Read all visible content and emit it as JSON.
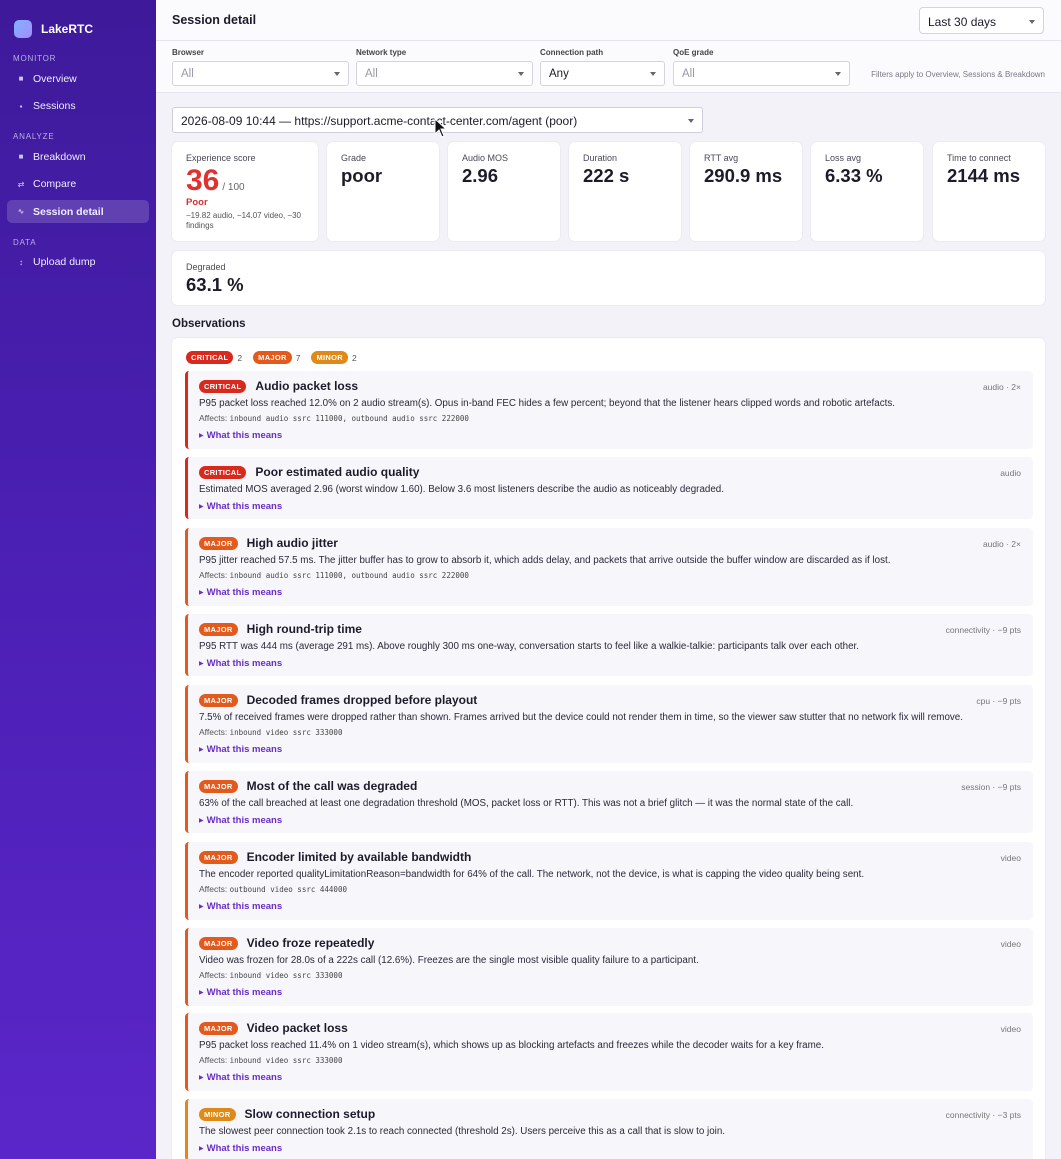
{
  "app": {
    "name": "LakeRTC"
  },
  "sidebar": {
    "sections": [
      {
        "label": "MONITOR",
        "items": [
          {
            "label": "Overview"
          },
          {
            "label": "Sessions"
          }
        ]
      },
      {
        "label": "ANALYZE",
        "items": [
          {
            "label": "Breakdown"
          },
          {
            "label": "Compare"
          },
          {
            "label": "Session detail",
            "active": true
          }
        ]
      },
      {
        "label": "DATA",
        "items": [
          {
            "label": "Upload dump"
          }
        ]
      }
    ]
  },
  "header": {
    "title": "Session detail",
    "range": "Last 30 days"
  },
  "filters": {
    "browser": {
      "label": "Browser",
      "value": "All"
    },
    "network": {
      "label": "Network type",
      "value": "All"
    },
    "path": {
      "label": "Connection path",
      "value": "Any"
    },
    "grade": {
      "label": "QoE grade",
      "value": "All"
    },
    "note": "Filters apply to Overview, Sessions & Breakdown"
  },
  "session_picker": {
    "value": "2026-08-09 10:44 — https://support.acme-contact-center.com/agent (poor)"
  },
  "stats": {
    "score": {
      "label": "Experience score",
      "value": "36",
      "max": "/ 100",
      "grade": "Poor",
      "detail": "−19.82 audio, −14.07 video, −30 findings"
    },
    "grade": {
      "label": "Grade",
      "value": "poor"
    },
    "mos": {
      "label": "Audio MOS",
      "value": "2.96"
    },
    "duration": {
      "label": "Duration",
      "value": "222 s"
    },
    "rtt": {
      "label": "RTT avg",
      "value": "290.9 ms"
    },
    "loss": {
      "label": "Loss avg",
      "value": "6.33 %"
    },
    "ttc": {
      "label": "Time to connect",
      "value": "2144 ms"
    },
    "degraded": {
      "label": "Degraded",
      "value": "63.1 %"
    }
  },
  "observations": {
    "title": "Observations",
    "counts": {
      "critical_label": "CRITICAL",
      "critical": "2",
      "major_label": "MAJOR",
      "major": "7",
      "minor_label": "MINOR",
      "minor": "2"
    },
    "more_label": "What this means",
    "items": [
      {
        "severity": "CRITICAL",
        "title": "Audio packet loss",
        "tag": "audio · 2×",
        "desc": "P95 packet loss reached 12.0% on 2 audio stream(s). Opus in-band FEC hides a few percent; beyond that the listener hears clipped words and robotic artefacts.",
        "affects_label": "Affects:",
        "affects": "inbound audio ssrc 111000, outbound audio ssrc 222000"
      },
      {
        "severity": "CRITICAL",
        "title": "Poor estimated audio quality",
        "tag": "audio",
        "desc": "Estimated MOS averaged 2.96 (worst window 1.60). Below 3.6 most listeners describe the audio as noticeably degraded."
      },
      {
        "severity": "MAJOR",
        "title": "High audio jitter",
        "tag": "audio · 2×",
        "desc": "P95 jitter reached 57.5 ms. The jitter buffer has to grow to absorb it, which adds delay, and packets that arrive outside the buffer window are discarded as if lost.",
        "affects_label": "Affects:",
        "affects": "inbound audio ssrc 111000, outbound audio ssrc 222000"
      },
      {
        "severity": "MAJOR",
        "title": "High round-trip time",
        "tag": "connectivity · −9 pts",
        "desc": "P95 RTT was 444 ms (average 291 ms). Above roughly 300 ms one-way, conversation starts to feel like a walkie-talkie: participants talk over each other."
      },
      {
        "severity": "MAJOR",
        "title": "Decoded frames dropped before playout",
        "tag": "cpu · −9 pts",
        "desc": "7.5% of received frames were dropped rather than shown. Frames arrived but the device could not render them in time, so the viewer saw stutter that no network fix will remove.",
        "affects_label": "Affects:",
        "affects": "inbound video ssrc 333000"
      },
      {
        "severity": "MAJOR",
        "title": "Most of the call was degraded",
        "tag": "session · −9 pts",
        "desc": "63% of the call breached at least one degradation threshold (MOS, packet loss or RTT). This was not a brief glitch — it was the normal state of the call."
      },
      {
        "severity": "MAJOR",
        "title": "Encoder limited by available bandwidth",
        "tag": "video",
        "desc": "The encoder reported qualityLimitationReason=bandwidth for 64% of the call. The network, not the device, is what is capping the video quality being sent.",
        "affects_label": "Affects:",
        "affects": "outbound video ssrc 444000"
      },
      {
        "severity": "MAJOR",
        "title": "Video froze repeatedly",
        "tag": "video",
        "desc": "Video was frozen for 28.0s of a 222s call (12.6%). Freezes are the single most visible quality failure to a participant.",
        "affects_label": "Affects:",
        "affects": "inbound video ssrc 333000"
      },
      {
        "severity": "MAJOR",
        "title": "Video packet loss",
        "tag": "video",
        "desc": "P95 packet loss reached 11.4% on 1 video stream(s), which shows up as blocking artefacts and freezes while the decoder waits for a key frame.",
        "affects_label": "Affects:",
        "affects": "inbound video ssrc 333000"
      },
      {
        "severity": "MINOR",
        "title": "Slow connection setup",
        "tag": "connectivity · −3 pts",
        "desc": "The slowest peer connection took 2.1s to reach connected (threshold 2s). Users perceive this as a call that is slow to join."
      }
    ]
  }
}
